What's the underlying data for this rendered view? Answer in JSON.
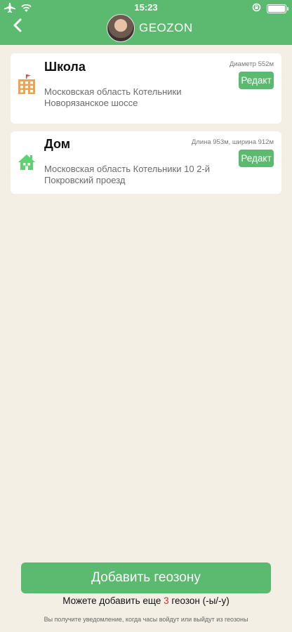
{
  "status_bar": {
    "time": "15:23",
    "icons": [
      "airplane-icon",
      "wifi-icon",
      "rotation-lock-icon",
      "battery-icon"
    ]
  },
  "header": {
    "title": "GEOZON",
    "back_icon": "chevron-left-icon",
    "color": "#5bba6f"
  },
  "zones": [
    {
      "name": "Школа",
      "icon": "school-icon",
      "size": "Диаметр 552м",
      "edit_label": "Редакт",
      "address": "Московская область Котельники Новорязанское шоссе"
    },
    {
      "name": "Дом",
      "icon": "home-icon",
      "size": "Длина 953м, ширина 912м",
      "edit_label": "Редакт",
      "address": "Московская область Котельники  10 2-й Покровский проезд"
    }
  ],
  "footer": {
    "add_button_label": "Добавить геозону",
    "can_add_prefix": "Можете добавить еще ",
    "can_add_count": "3",
    "can_add_suffix": " геозон (-ы/-у)",
    "note": "Вы получите уведомление, когда часы войдут или выйдут из геозоны"
  },
  "colors": {
    "accent": "#5bba6f",
    "background": "#f4efe4",
    "count_highlight": "#d0312d"
  }
}
